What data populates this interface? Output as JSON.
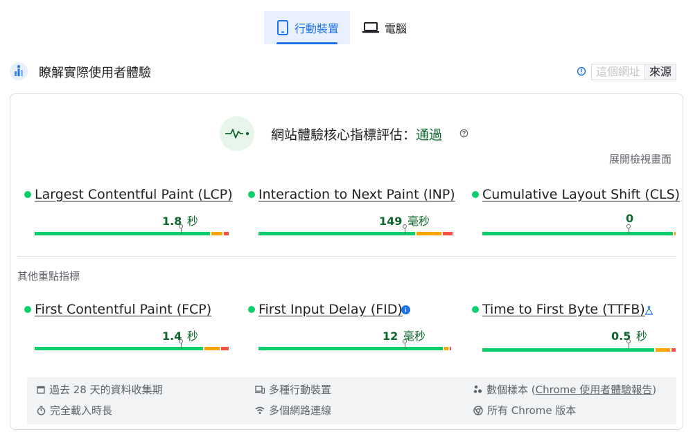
{
  "tabs": [
    {
      "label": "行動裝置",
      "icon": "smartphone-icon",
      "active": true
    },
    {
      "label": "電腦",
      "icon": "laptop-icon",
      "active": false
    }
  ],
  "header": {
    "title": "瞭解實際使用者體驗",
    "url_option": "這個網址",
    "origin_option": "來源"
  },
  "assessment": {
    "label": "網站體驗核心指標評估：",
    "result": "通過",
    "expand_link": "展開檢視畫面"
  },
  "core_metrics": [
    {
      "name": "Largest Contentful Paint (LCP)",
      "value": "1.8",
      "unit": "秒",
      "status": "good"
    },
    {
      "name": "Interaction to Next Paint (INP)",
      "value": "149",
      "unit": "毫秒",
      "status": "good"
    },
    {
      "name": "Cumulative Layout Shift (CLS)",
      "value": "0",
      "unit": "",
      "status": "good"
    }
  ],
  "other_metrics_title": "其他重點指標",
  "other_metrics": [
    {
      "name": "First Contentful Paint (FCP)",
      "value": "1.4",
      "unit": "秒",
      "status": "good"
    },
    {
      "name": "First Input Delay (FID)",
      "value": "12",
      "unit": "毫秒",
      "status": "good",
      "icon": "info-icon"
    },
    {
      "name": "Time to First Byte (TTFB)",
      "value": "0.5",
      "unit": "秒",
      "status": "good",
      "icon": "experimental-icon"
    }
  ],
  "footer": {
    "collection_period": "過去 28 天的資料收集期",
    "devices": "多種行動裝置",
    "samples_prefix": "數個樣本 (",
    "samples_link": "Chrome 使用者體驗報告",
    "samples_suffix": ")",
    "full_load": "完全載入時長",
    "network": "多個網路連線",
    "chrome_versions": "所有 Chrome 版本"
  },
  "colors": {
    "accent": "#1a73e8",
    "good": "#0cce6b",
    "needs_improvement": "#ffa400",
    "poor": "#ff4e42",
    "pass_text": "#0d652d"
  }
}
